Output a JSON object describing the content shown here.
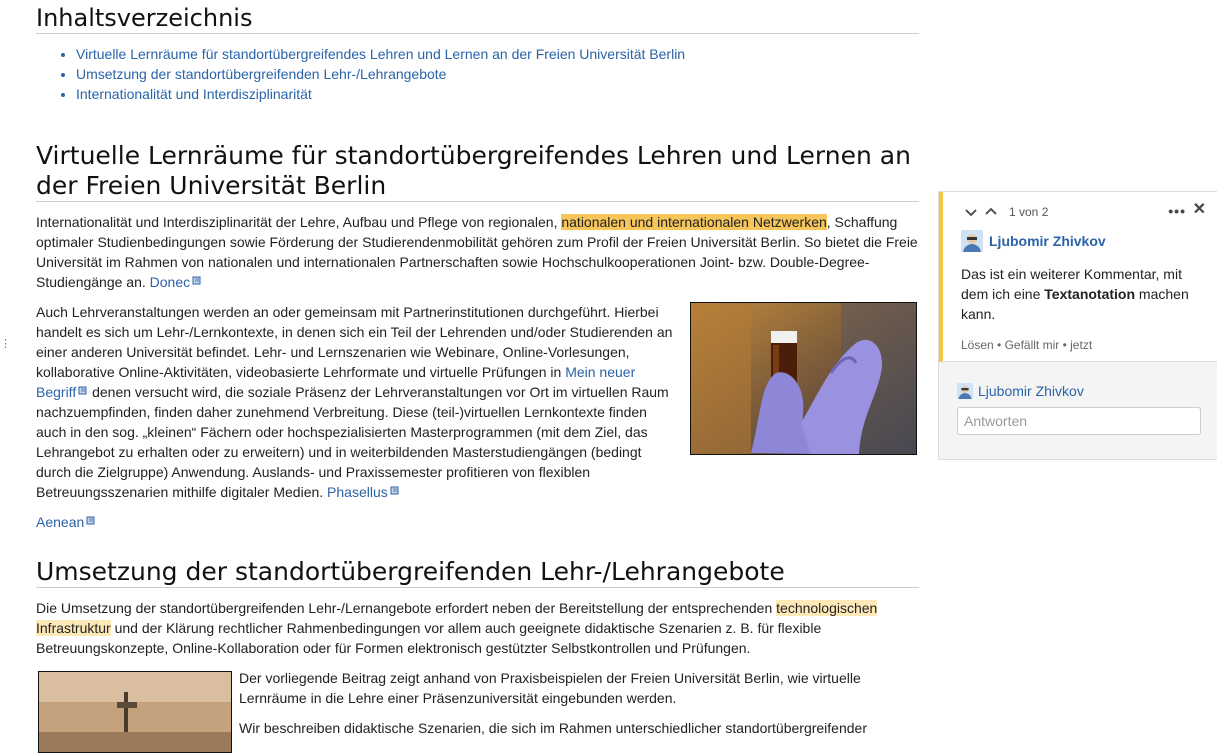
{
  "toc": {
    "title": "Inhaltsverzeichnis",
    "items": [
      "Virtuelle Lernräume für standortübergreifendes Lehren und Lernen an der Freien Universität Berlin",
      "Umsetzung der standortübergreifenden Lehr-/Lehrangebote",
      "Internationalität und Interdisziplinarität"
    ]
  },
  "section1": {
    "heading": "Virtuelle Lernräume für standortübergreifendes Lehren und Lernen an der Freien Universität Berlin",
    "p1_before": "Internationalität und Interdisziplinarität der Lehre, Aufbau und Pflege von regionalen, ",
    "p1_highlight": "nationalen und internationalen Netzwerken",
    "p1_after": ", Schaffung optimaler Studienbedingungen sowie Förderung der Studierendenmobilität gehören zum Profil der Freien Universität Berlin. So bietet die Freie Universität im Rahmen von nationalen und internationalen Partnerschaften sowie Hochschulkooperationen Joint- bzw. Double-Degree-Studiengänge an. ",
    "p1_link": "Donec",
    "p2_before": "Auch Lehrveranstaltungen werden an oder gemeinsam mit Partnerinstitutionen durchgeführt. Hierbei handelt es sich um Lehr-/Lernkontexte, in denen sich ein Teil der Lehrenden und/oder Studierenden an einer anderen Universität befindet. Lehr- und Lernszenarien wie Webinare, Online-Vorlesungen, kollaborative Online-Aktivitäten, videobasierte Lehrformate und virtuelle Prüfungen in ",
    "p2_link1": "Mein neuer Begriff",
    "p2_after": " denen versucht wird, die soziale Präsenz der Lehrveranstaltungen vor Ort im virtuellen Raum nachzuempfinden, finden daher zunehmend Verbreitung. Diese (teil-)virtuellen Lernkontexte finden auch in den sog. „kleinen“ Fächern oder hochspezialisierten Masterprogrammen (mit dem Ziel, das Lehrangebot zu erhalten oder zu erweitern) und in weiterbildenden Masterstudiengängen (bedingt durch die Zielgruppe) Anwendung. Auslands- und Praxissemester profitieren von flexiblen Betreuungsszenarien mithilfe digitaler Medien. ",
    "p2_link2": "Phasellus",
    "p3_link": "Aenean"
  },
  "section2": {
    "heading": "Umsetzung der standortübergreifenden Lehr-/Lehrangebote",
    "p1_before": "Die Umsetzung der standortübergreifenden Lehr-/Lernangebote erfordert neben der Bereitstellung der entsprechenden ",
    "p1_highlight": "technologischen Infrastruktur",
    "p1_after": " und der Klärung rechtlicher Rahmenbedingungen vor allem auch geeignete didaktische Szenarien z. B. für flexible Betreuungskonzepte, Online-Kollaboration oder für Formen elektronisch gestützter Selbstkontrollen und Prüfungen.",
    "p2": "Der vorliegende Beitrag zeigt anhand von Praxisbeispielen der Freien Universität Berlin, wie virtuelle Lernräume in die Lehre einer Präsenzuniversität eingebunden werden.",
    "p3": "Wir beschreiben didaktische Szenarien, die sich im Rahmen unterschiedlicher standortübergreifender"
  },
  "comment": {
    "counter": "1 von 2",
    "more": "•••",
    "close": "✕",
    "author": "Ljubomir Zhivkov",
    "body_before": "Das ist ein weiterer Kommentar, mit dem ich eine ",
    "body_bold": "Textanotation",
    "body_after": " machen kann.",
    "action_resolve": "Lösen",
    "action_like": "Gefällt mir",
    "time": "jetzt",
    "sep": " • ",
    "reply_author": "Ljubomir Zhivkov",
    "reply_placeholder": "Antworten"
  },
  "edge_mark": "⋮",
  "colors": {
    "link": "#2a63a8",
    "highlight": "#f6c65b",
    "highlight_light": "#fde8b8",
    "comment_accent": "#f2c744"
  }
}
